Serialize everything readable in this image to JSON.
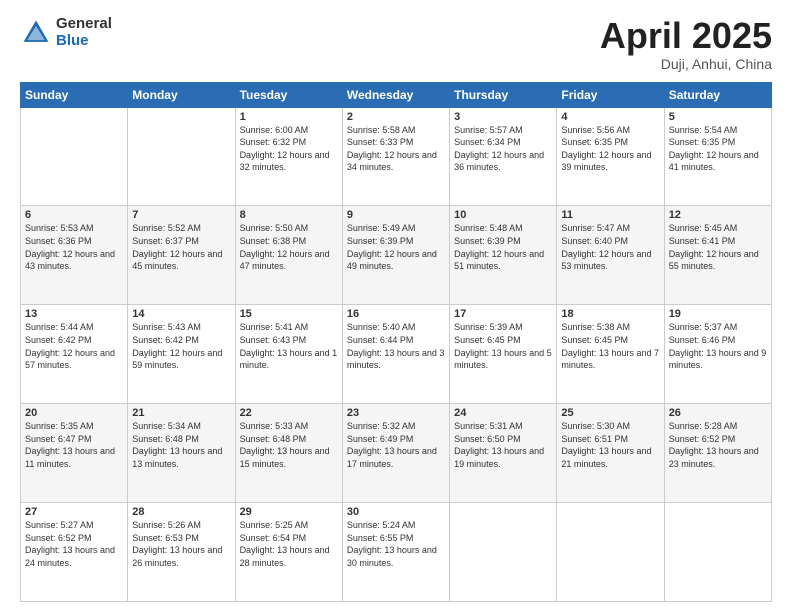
{
  "logo": {
    "general": "General",
    "blue": "Blue"
  },
  "title": {
    "month": "April 2025",
    "location": "Duji, Anhui, China"
  },
  "weekdays": [
    "Sunday",
    "Monday",
    "Tuesday",
    "Wednesday",
    "Thursday",
    "Friday",
    "Saturday"
  ],
  "weeks": [
    [
      {
        "day": "",
        "sunrise": "",
        "sunset": "",
        "daylight": ""
      },
      {
        "day": "",
        "sunrise": "",
        "sunset": "",
        "daylight": ""
      },
      {
        "day": "1",
        "sunrise": "Sunrise: 6:00 AM",
        "sunset": "Sunset: 6:32 PM",
        "daylight": "Daylight: 12 hours and 32 minutes."
      },
      {
        "day": "2",
        "sunrise": "Sunrise: 5:58 AM",
        "sunset": "Sunset: 6:33 PM",
        "daylight": "Daylight: 12 hours and 34 minutes."
      },
      {
        "day": "3",
        "sunrise": "Sunrise: 5:57 AM",
        "sunset": "Sunset: 6:34 PM",
        "daylight": "Daylight: 12 hours and 36 minutes."
      },
      {
        "day": "4",
        "sunrise": "Sunrise: 5:56 AM",
        "sunset": "Sunset: 6:35 PM",
        "daylight": "Daylight: 12 hours and 39 minutes."
      },
      {
        "day": "5",
        "sunrise": "Sunrise: 5:54 AM",
        "sunset": "Sunset: 6:35 PM",
        "daylight": "Daylight: 12 hours and 41 minutes."
      }
    ],
    [
      {
        "day": "6",
        "sunrise": "Sunrise: 5:53 AM",
        "sunset": "Sunset: 6:36 PM",
        "daylight": "Daylight: 12 hours and 43 minutes."
      },
      {
        "day": "7",
        "sunrise": "Sunrise: 5:52 AM",
        "sunset": "Sunset: 6:37 PM",
        "daylight": "Daylight: 12 hours and 45 minutes."
      },
      {
        "day": "8",
        "sunrise": "Sunrise: 5:50 AM",
        "sunset": "Sunset: 6:38 PM",
        "daylight": "Daylight: 12 hours and 47 minutes."
      },
      {
        "day": "9",
        "sunrise": "Sunrise: 5:49 AM",
        "sunset": "Sunset: 6:39 PM",
        "daylight": "Daylight: 12 hours and 49 minutes."
      },
      {
        "day": "10",
        "sunrise": "Sunrise: 5:48 AM",
        "sunset": "Sunset: 6:39 PM",
        "daylight": "Daylight: 12 hours and 51 minutes."
      },
      {
        "day": "11",
        "sunrise": "Sunrise: 5:47 AM",
        "sunset": "Sunset: 6:40 PM",
        "daylight": "Daylight: 12 hours and 53 minutes."
      },
      {
        "day": "12",
        "sunrise": "Sunrise: 5:45 AM",
        "sunset": "Sunset: 6:41 PM",
        "daylight": "Daylight: 12 hours and 55 minutes."
      }
    ],
    [
      {
        "day": "13",
        "sunrise": "Sunrise: 5:44 AM",
        "sunset": "Sunset: 6:42 PM",
        "daylight": "Daylight: 12 hours and 57 minutes."
      },
      {
        "day": "14",
        "sunrise": "Sunrise: 5:43 AM",
        "sunset": "Sunset: 6:42 PM",
        "daylight": "Daylight: 12 hours and 59 minutes."
      },
      {
        "day": "15",
        "sunrise": "Sunrise: 5:41 AM",
        "sunset": "Sunset: 6:43 PM",
        "daylight": "Daylight: 13 hours and 1 minute."
      },
      {
        "day": "16",
        "sunrise": "Sunrise: 5:40 AM",
        "sunset": "Sunset: 6:44 PM",
        "daylight": "Daylight: 13 hours and 3 minutes."
      },
      {
        "day": "17",
        "sunrise": "Sunrise: 5:39 AM",
        "sunset": "Sunset: 6:45 PM",
        "daylight": "Daylight: 13 hours and 5 minutes."
      },
      {
        "day": "18",
        "sunrise": "Sunrise: 5:38 AM",
        "sunset": "Sunset: 6:45 PM",
        "daylight": "Daylight: 13 hours and 7 minutes."
      },
      {
        "day": "19",
        "sunrise": "Sunrise: 5:37 AM",
        "sunset": "Sunset: 6:46 PM",
        "daylight": "Daylight: 13 hours and 9 minutes."
      }
    ],
    [
      {
        "day": "20",
        "sunrise": "Sunrise: 5:35 AM",
        "sunset": "Sunset: 6:47 PM",
        "daylight": "Daylight: 13 hours and 11 minutes."
      },
      {
        "day": "21",
        "sunrise": "Sunrise: 5:34 AM",
        "sunset": "Sunset: 6:48 PM",
        "daylight": "Daylight: 13 hours and 13 minutes."
      },
      {
        "day": "22",
        "sunrise": "Sunrise: 5:33 AM",
        "sunset": "Sunset: 6:48 PM",
        "daylight": "Daylight: 13 hours and 15 minutes."
      },
      {
        "day": "23",
        "sunrise": "Sunrise: 5:32 AM",
        "sunset": "Sunset: 6:49 PM",
        "daylight": "Daylight: 13 hours and 17 minutes."
      },
      {
        "day": "24",
        "sunrise": "Sunrise: 5:31 AM",
        "sunset": "Sunset: 6:50 PM",
        "daylight": "Daylight: 13 hours and 19 minutes."
      },
      {
        "day": "25",
        "sunrise": "Sunrise: 5:30 AM",
        "sunset": "Sunset: 6:51 PM",
        "daylight": "Daylight: 13 hours and 21 minutes."
      },
      {
        "day": "26",
        "sunrise": "Sunrise: 5:28 AM",
        "sunset": "Sunset: 6:52 PM",
        "daylight": "Daylight: 13 hours and 23 minutes."
      }
    ],
    [
      {
        "day": "27",
        "sunrise": "Sunrise: 5:27 AM",
        "sunset": "Sunset: 6:52 PM",
        "daylight": "Daylight: 13 hours and 24 minutes."
      },
      {
        "day": "28",
        "sunrise": "Sunrise: 5:26 AM",
        "sunset": "Sunset: 6:53 PM",
        "daylight": "Daylight: 13 hours and 26 minutes."
      },
      {
        "day": "29",
        "sunrise": "Sunrise: 5:25 AM",
        "sunset": "Sunset: 6:54 PM",
        "daylight": "Daylight: 13 hours and 28 minutes."
      },
      {
        "day": "30",
        "sunrise": "Sunrise: 5:24 AM",
        "sunset": "Sunset: 6:55 PM",
        "daylight": "Daylight: 13 hours and 30 minutes."
      },
      {
        "day": "",
        "sunrise": "",
        "sunset": "",
        "daylight": ""
      },
      {
        "day": "",
        "sunrise": "",
        "sunset": "",
        "daylight": ""
      },
      {
        "day": "",
        "sunrise": "",
        "sunset": "",
        "daylight": ""
      }
    ]
  ]
}
